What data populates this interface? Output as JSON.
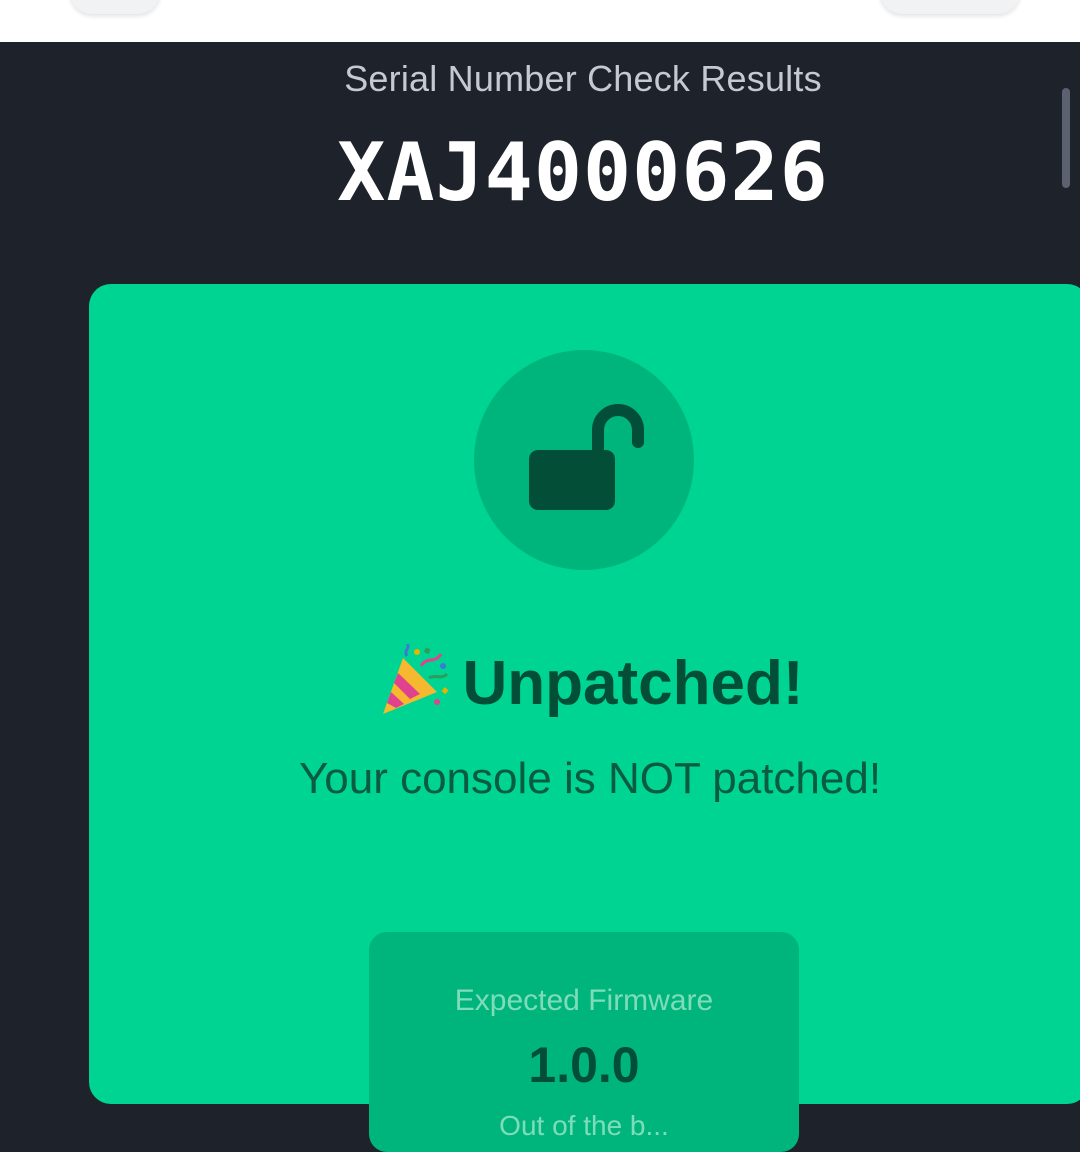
{
  "header": {
    "subtitle": "Serial Number Check Results",
    "serial_number": "XAJ4000626"
  },
  "result": {
    "status_icon": "unlocked-padlock-icon",
    "emoji_icon": "party-popper-icon",
    "status_title": "Unpatched!",
    "status_description": "Your console is NOT patched!",
    "firmware": {
      "label": "Expected Firmware",
      "value": "1.0.0",
      "note_partial": "Out of the b..."
    }
  },
  "colors": {
    "background": "#1e222b",
    "card_green": "#00d492",
    "dark_green": "#034e37",
    "accent_green": "#00b57c"
  }
}
